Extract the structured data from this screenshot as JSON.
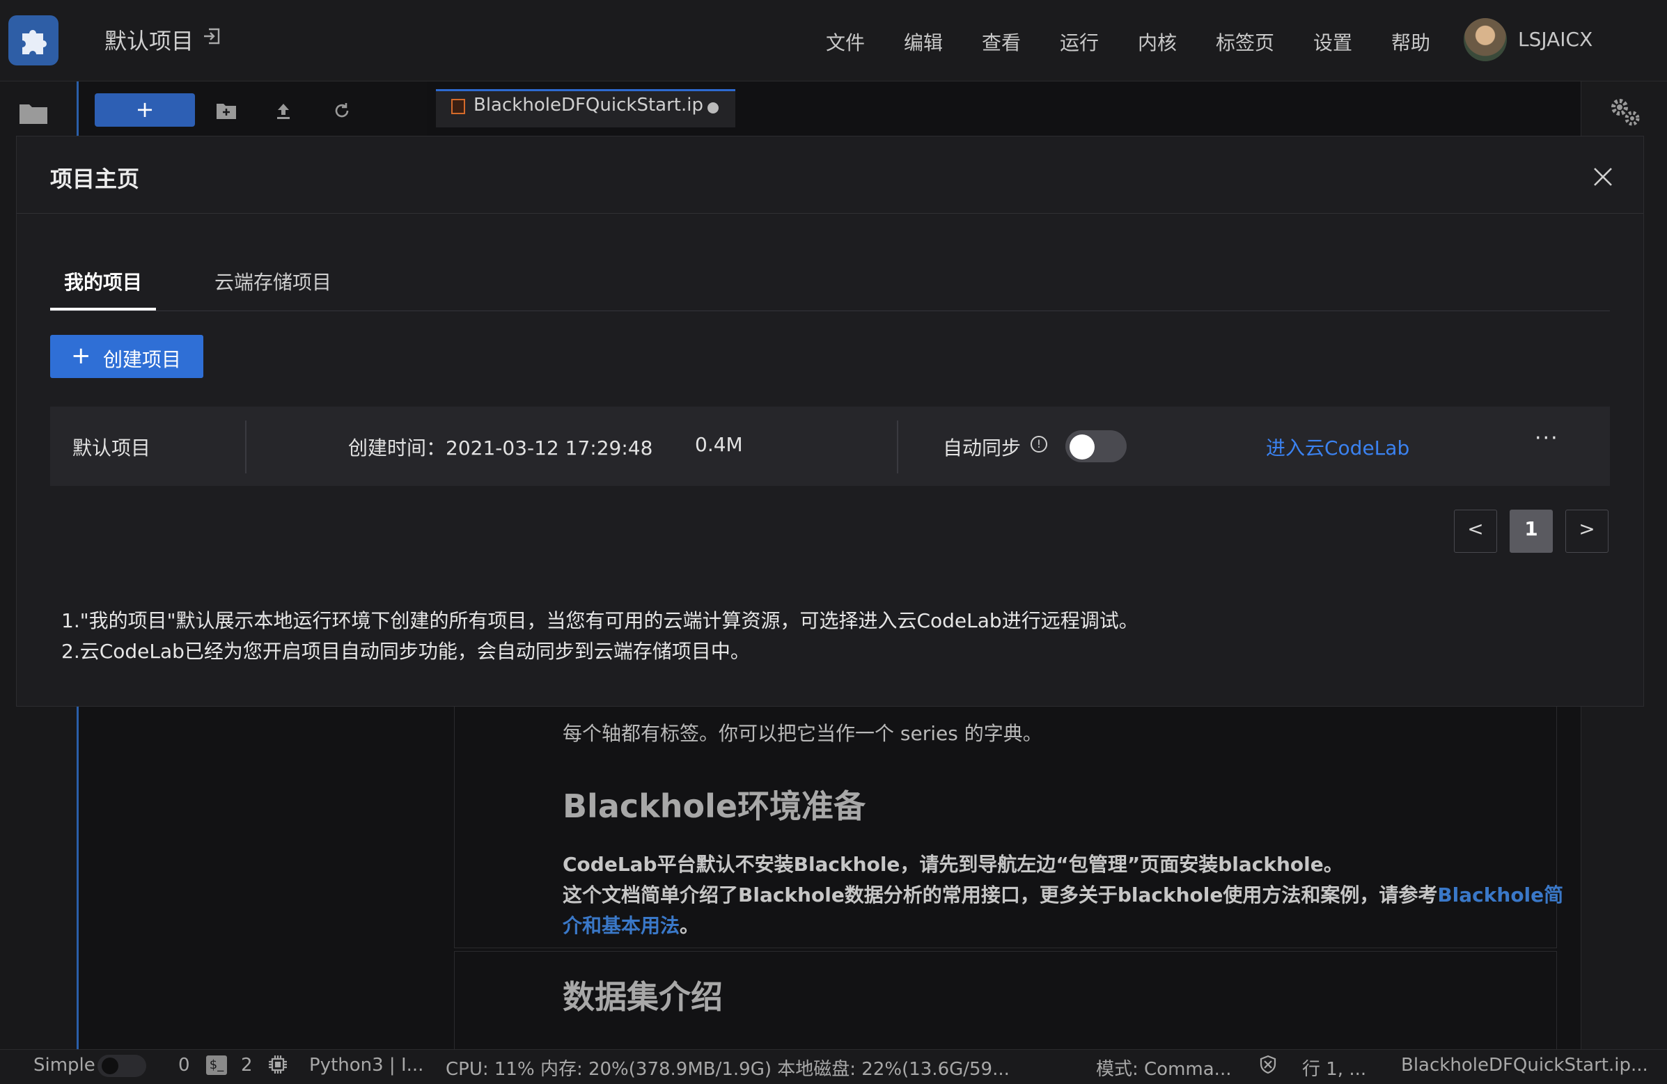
{
  "app": {
    "project_title": "默认项目",
    "menu": [
      "文件",
      "编辑",
      "查看",
      "运行",
      "内核",
      "标签页",
      "设置",
      "帮助"
    ],
    "username": "LSJAICX"
  },
  "toolbar": {
    "new_label": "+",
    "open_tab": "BlackholeDFQuickStart.ipynb"
  },
  "notebook": {
    "line_series": "每个轴都有标签。你可以把它当作一个 series 的字典。",
    "heading_env": "Blackhole环境准备",
    "para_line1": "CodeLab平台默认不安装Blackhole，请先到导航左边“包管理”页面安装blackhole。",
    "para_line2_a": "这个文档简单介绍了Blackhole数据分析的常用接口，更多关于blackhole使用方法和案例，请参考",
    "para_link_a": "Blackhole简",
    "para_link_b": "介和基本用法",
    "para_end": "。",
    "heading_dataset": "数据集介绍"
  },
  "modal": {
    "title": "项目主页",
    "tabs": [
      {
        "label": "我的项目",
        "active": true
      },
      {
        "label": "云端存储项目",
        "active": false
      }
    ],
    "create_button": "创建项目",
    "create_plus": "+",
    "projects": [
      {
        "name": "默认项目",
        "created_label": "创建时间：",
        "created": "2021-03-12 17:29:48",
        "size": "0.4M",
        "sync_label": "自动同步",
        "sync_enabled": false,
        "enter_link": "进入云CodeLab",
        "more": "···"
      }
    ],
    "pagination": {
      "prev": "<",
      "current": "1",
      "next": ">"
    },
    "notes": [
      "1.\"我的项目\"默认展示本地运行环境下创建的所有项目，当您有可用的云端计算资源，可选择进入云CodeLab进行远程调试。",
      "2.云CodeLab已经为您开启项目自动同步功能，会自动同步到云端存储项目中。"
    ]
  },
  "status": {
    "mode_name": "Simple",
    "count_a": "0",
    "terminal_glyph": "$_",
    "count_b": "2",
    "kernel": "Python3 | I...",
    "resources": "CPU:  11% 内存:  20%(378.9MB/1.9G) 本地磁盘:  22%(13.6G/59...",
    "mode": "模式:  Comma...",
    "cursor": "行 1, ...",
    "file": "BlackholeDFQuickStart.ip..."
  },
  "colors": {
    "accent": "#2f6fd6",
    "link": "#3b82f0",
    "background": "#111113",
    "modal": "#1d1d20"
  }
}
